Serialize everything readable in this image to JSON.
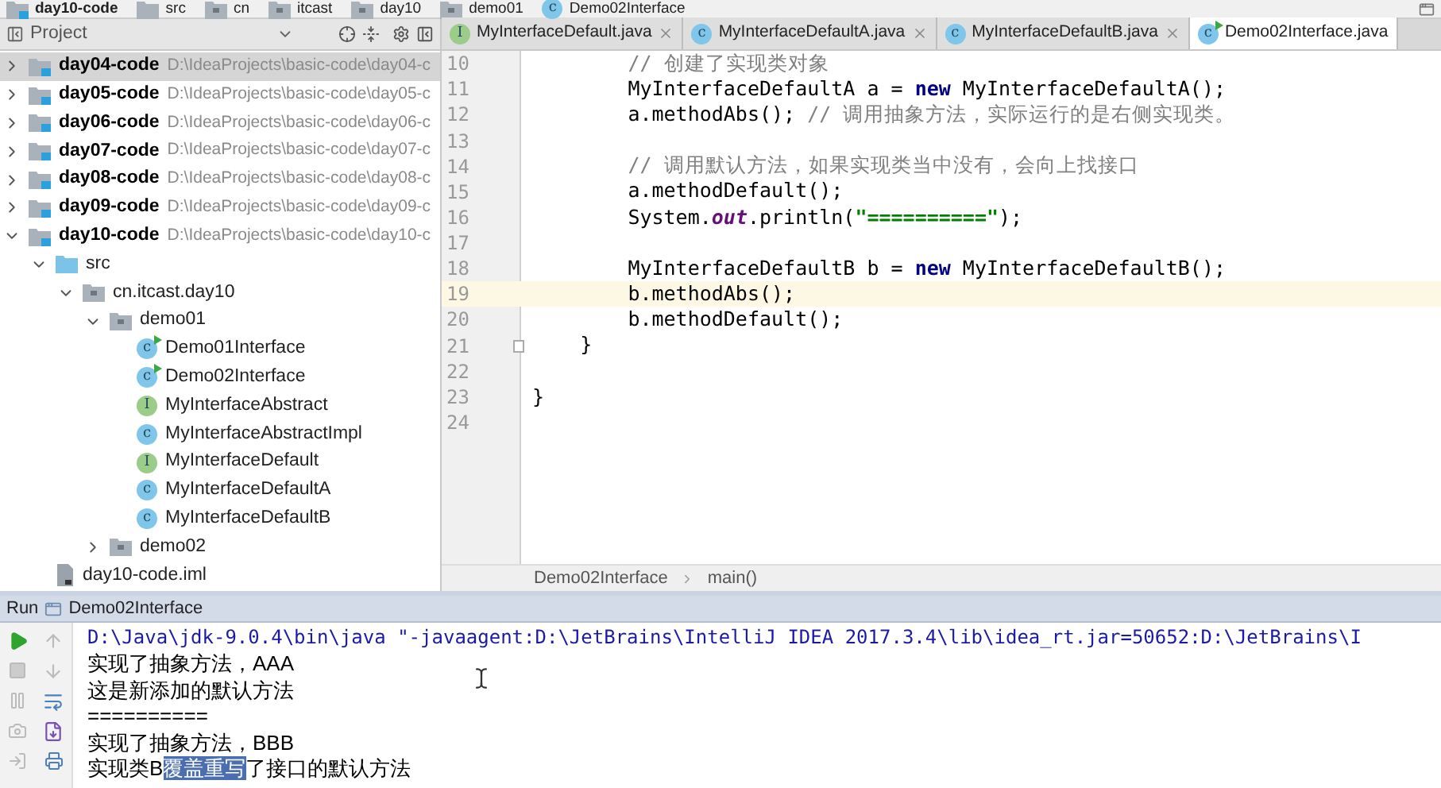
{
  "nav_bar": [
    {
      "label": "day10-code",
      "kind": "module"
    },
    {
      "label": "src",
      "kind": "folder"
    },
    {
      "label": "cn",
      "kind": "package"
    },
    {
      "label": "itcast",
      "kind": "package"
    },
    {
      "label": "day10",
      "kind": "package"
    },
    {
      "label": "demo01",
      "kind": "package"
    },
    {
      "label": "Demo02Interface",
      "kind": "class",
      "icon_letter": "c"
    }
  ],
  "project_panel": {
    "title": "Project",
    "tree": [
      {
        "name": "day04-code",
        "path": "D:\\IdeaProjects\\basic-code\\day04-c",
        "kind": "module",
        "expanded": false,
        "selected": true
      },
      {
        "name": "day05-code",
        "path": "D:\\IdeaProjects\\basic-code\\day05-c",
        "kind": "module",
        "expanded": false,
        "selected": false
      },
      {
        "name": "day06-code",
        "path": "D:\\IdeaProjects\\basic-code\\day06-c",
        "kind": "module",
        "expanded": false,
        "selected": false
      },
      {
        "name": "day07-code",
        "path": "D:\\IdeaProjects\\basic-code\\day07-c",
        "kind": "module",
        "expanded": false,
        "selected": false
      },
      {
        "name": "day08-code",
        "path": "D:\\IdeaProjects\\basic-code\\day08-c",
        "kind": "module",
        "expanded": false,
        "selected": false
      },
      {
        "name": "day09-code",
        "path": "D:\\IdeaProjects\\basic-code\\day09-c",
        "kind": "module",
        "expanded": false,
        "selected": false
      },
      {
        "name": "day10-code",
        "path": "D:\\IdeaProjects\\basic-code\\day10-c",
        "kind": "module",
        "expanded": true,
        "selected": false,
        "children": [
          {
            "name": "src",
            "kind": "source",
            "expanded": true,
            "selected": false,
            "children": [
              {
                "name": "cn.itcast.day10",
                "kind": "package",
                "expanded": true,
                "selected": false,
                "children": [
                  {
                    "name": "demo01",
                    "kind": "package",
                    "expanded": true,
                    "selected": false,
                    "children": [
                      {
                        "name": "Demo01Interface",
                        "kind": "runnable_class",
                        "icon_letter": "c",
                        "selected": false
                      },
                      {
                        "name": "Demo02Interface",
                        "kind": "runnable_class",
                        "icon_letter": "c",
                        "selected": false
                      },
                      {
                        "name": "MyInterfaceAbstract",
                        "kind": "interface",
                        "icon_letter": "I",
                        "selected": false
                      },
                      {
                        "name": "MyInterfaceAbstractImpl",
                        "kind": "class",
                        "icon_letter": "c",
                        "selected": false
                      },
                      {
                        "name": "MyInterfaceDefault",
                        "kind": "interface",
                        "icon_letter": "I",
                        "selected": false
                      },
                      {
                        "name": "MyInterfaceDefaultA",
                        "kind": "class",
                        "icon_letter": "c",
                        "selected": false
                      },
                      {
                        "name": "MyInterfaceDefaultB",
                        "kind": "class",
                        "icon_letter": "c",
                        "selected": false
                      }
                    ]
                  },
                  {
                    "name": "demo02",
                    "kind": "package",
                    "expanded": false,
                    "selected": false
                  }
                ]
              }
            ]
          },
          {
            "name": "day10-code.iml",
            "kind": "file",
            "selected": false
          }
        ]
      }
    ]
  },
  "editor": {
    "tabs": [
      {
        "label": "MyInterfaceDefault.java",
        "kind": "interface",
        "icon_letter": "I",
        "selected": false
      },
      {
        "label": "MyInterfaceDefaultA.java",
        "kind": "class",
        "icon_letter": "c",
        "selected": false
      },
      {
        "label": "MyInterfaceDefaultB.java",
        "kind": "class",
        "icon_letter": "c",
        "selected": false
      },
      {
        "label": "Demo02Interface.java",
        "kind": "runnable_class",
        "icon_letter": "c",
        "selected": true
      }
    ],
    "lines": [
      {
        "number": "10",
        "current": false,
        "tokens": [
          {
            "kind": "comment",
            "text": "        // 创建了实现类对象"
          }
        ]
      },
      {
        "number": "11",
        "current": false,
        "tokens": [
          {
            "kind": "plain",
            "text": "        MyInterfaceDefaultA a = "
          },
          {
            "kind": "keyword",
            "text": "new"
          },
          {
            "kind": "plain",
            "text": " MyInterfaceDefaultA();"
          }
        ]
      },
      {
        "number": "12",
        "current": false,
        "tokens": [
          {
            "kind": "plain",
            "text": "        a.methodAbs(); "
          },
          {
            "kind": "comment",
            "text": "// 调用抽象方法，实际运行的是右侧实现类。"
          }
        ]
      },
      {
        "number": "13",
        "current": false
      },
      {
        "number": "14",
        "current": false,
        "tokens": [
          {
            "kind": "comment",
            "text": "        // 调用默认方法，如果实现类当中没有，会向上找接口"
          }
        ]
      },
      {
        "number": "15",
        "current": false,
        "tokens": [
          {
            "kind": "plain",
            "text": "        a.methodDefault();"
          }
        ]
      },
      {
        "number": "16",
        "current": false,
        "tokens": [
          {
            "kind": "plain",
            "text": "        System."
          },
          {
            "kind": "static",
            "text": "out"
          },
          {
            "kind": "plain",
            "text": ".println("
          },
          {
            "kind": "string",
            "text": "\"==========\""
          },
          {
            "kind": "plain",
            "text": ");"
          }
        ]
      },
      {
        "number": "17",
        "current": false
      },
      {
        "number": "18",
        "current": false,
        "tokens": [
          {
            "kind": "plain",
            "text": "        MyInterfaceDefaultB b = "
          },
          {
            "kind": "keyword",
            "text": "new"
          },
          {
            "kind": "plain",
            "text": " MyInterfaceDefaultB();"
          }
        ]
      },
      {
        "number": "19",
        "current": true,
        "tokens": [
          {
            "kind": "plain",
            "text": "        b.methodAbs();"
          }
        ]
      },
      {
        "number": "20",
        "current": false,
        "tokens": [
          {
            "kind": "plain",
            "text": "        b.methodDefault();"
          }
        ]
      },
      {
        "number": "21",
        "current": false,
        "fold": true,
        "tokens": [
          {
            "kind": "plain",
            "text": "    }"
          }
        ]
      },
      {
        "number": "22",
        "current": false
      },
      {
        "number": "23",
        "current": false,
        "tokens": [
          {
            "kind": "plain",
            "text": "}"
          }
        ]
      },
      {
        "number": "24",
        "current": false
      }
    ],
    "breadcrumb": [
      "Demo02Interface",
      "main()"
    ]
  },
  "run_panel": {
    "title": "Run",
    "config": "Demo02Interface",
    "console": [
      {
        "kind": "command",
        "segments": [
          {
            "text": "D:\\Java\\jdk-9.0.4\\bin\\java \"-javaagent:D:\\JetBrains\\IntelliJ IDEA 2017.3.4\\lib\\idea_rt.jar=50652:D:\\JetBrains\\I",
            "selected": false
          }
        ]
      },
      {
        "kind": "output",
        "segments": [
          {
            "text": "实现了抽象方法，AAA",
            "selected": false
          }
        ]
      },
      {
        "kind": "output",
        "segments": [
          {
            "text": "这是新添加的默认方法",
            "selected": false
          }
        ]
      },
      {
        "kind": "output",
        "segments": [
          {
            "text": "==========",
            "selected": false
          }
        ]
      },
      {
        "kind": "output",
        "segments": [
          {
            "text": "实现了抽象方法，BBB",
            "selected": false
          }
        ]
      },
      {
        "kind": "output",
        "segments": [
          {
            "text": "实现类B",
            "selected": false
          },
          {
            "text": "覆盖重写",
            "selected": true
          },
          {
            "text": "了接口的默认方法",
            "selected": false
          }
        ]
      }
    ]
  }
}
